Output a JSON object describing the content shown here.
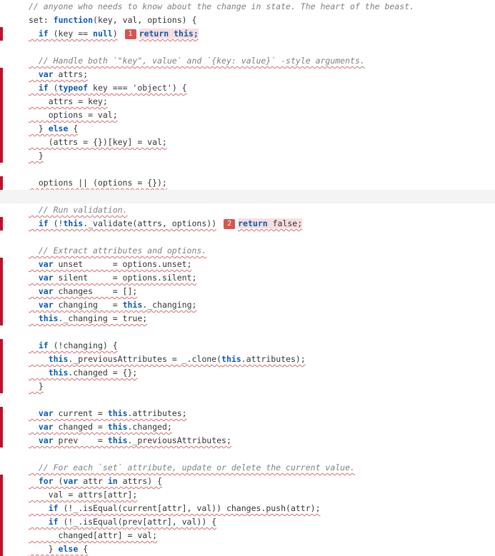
{
  "lines": [
    {
      "segs": [
        {
          "t": "// anyone who needs to know about the change in state. The heart of the beast.",
          "c": "cm"
        }
      ],
      "mark": false,
      "squig": false,
      "cls": "cover"
    },
    {
      "segs": [
        {
          "t": "set",
          "c": ""
        },
        {
          "t": ": ",
          "c": ""
        },
        {
          "t": "function",
          "c": "kw"
        },
        {
          "t": "(key, val, options) {",
          "c": ""
        }
      ],
      "mark": false,
      "squig": false,
      "cls": ""
    },
    {
      "segs": [
        {
          "t": "  if",
          "c": "kw"
        },
        {
          "t": " (key == ",
          "c": ""
        },
        {
          "t": "null",
          "c": "kw"
        },
        {
          "t": ")",
          "c": ""
        }
      ],
      "badge": "1",
      "after": [
        {
          "t": "return this;",
          "c": "kw"
        }
      ],
      "mark": true,
      "squig": true,
      "cls": ""
    },
    {
      "segs": [],
      "mark": false,
      "squig": false,
      "cls": "blank"
    },
    {
      "segs": [
        {
          "t": "  // Handle both `\"key\", value` and `{key: value}` -style arguments.",
          "c": "cm"
        }
      ],
      "mark": false,
      "squig": true,
      "cls": ""
    },
    {
      "segs": [
        {
          "t": "  var",
          "c": "kw"
        },
        {
          "t": " attrs;",
          "c": ""
        }
      ],
      "mark": true,
      "squig": true,
      "cls": ""
    },
    {
      "segs": [
        {
          "t": "  if",
          "c": "kw"
        },
        {
          "t": " (",
          "c": ""
        },
        {
          "t": "typeof",
          "c": "kw"
        },
        {
          "t": " key === ",
          "c": ""
        },
        {
          "t": "'object'",
          "c": "str"
        },
        {
          "t": ") {",
          "c": ""
        }
      ],
      "mark": true,
      "squig": true,
      "cls": ""
    },
    {
      "segs": [
        {
          "t": "    attrs = key;",
          "c": ""
        }
      ],
      "mark": true,
      "squig": true,
      "cls": ""
    },
    {
      "segs": [
        {
          "t": "    options = val;",
          "c": ""
        }
      ],
      "mark": true,
      "squig": true,
      "cls": ""
    },
    {
      "segs": [
        {
          "t": "  } ",
          "c": ""
        },
        {
          "t": "else",
          "c": "kw"
        },
        {
          "t": " {",
          "c": ""
        }
      ],
      "mark": true,
      "squig": true,
      "cls": ""
    },
    {
      "segs": [
        {
          "t": "    (attrs = {})[key] = val;",
          "c": ""
        }
      ],
      "mark": true,
      "squig": true,
      "cls": ""
    },
    {
      "segs": [
        {
          "t": "  }",
          "c": ""
        }
      ],
      "mark": true,
      "squig": true,
      "cls": ""
    },
    {
      "segs": [],
      "mark": false,
      "squig": false,
      "cls": "blank"
    },
    {
      "segs": [
        {
          "t": "  options || (options = {});",
          "c": ""
        }
      ],
      "mark": true,
      "squig": true,
      "cls": ""
    },
    {
      "segs": [],
      "mark": false,
      "squig": false,
      "cls": "band"
    },
    {
      "segs": [
        {
          "t": "  // Run validation.",
          "c": "cm"
        }
      ],
      "mark": false,
      "squig": true,
      "cls": ""
    },
    {
      "segs": [
        {
          "t": "  if",
          "c": "kw"
        },
        {
          "t": " (!",
          "c": ""
        },
        {
          "t": "this",
          "c": "kw"
        },
        {
          "t": "._validate(attrs, options))",
          "c": ""
        }
      ],
      "badge": "2",
      "after": [
        {
          "t": "return",
          "c": "kw"
        },
        {
          "t": " false;",
          "c": ""
        }
      ],
      "mark": true,
      "squig": true,
      "cls": ""
    },
    {
      "segs": [],
      "mark": false,
      "squig": false,
      "cls": "blank"
    },
    {
      "segs": [
        {
          "t": "  // Extract attributes and options.",
          "c": "cm"
        }
      ],
      "mark": false,
      "squig": true,
      "cls": ""
    },
    {
      "segs": [
        {
          "t": "  var",
          "c": "kw"
        },
        {
          "t": " unset      = options.unset;",
          "c": ""
        }
      ],
      "mark": true,
      "squig": true,
      "cls": ""
    },
    {
      "segs": [
        {
          "t": "  var",
          "c": "kw"
        },
        {
          "t": " silent     = options.silent;",
          "c": ""
        }
      ],
      "mark": true,
      "squig": true,
      "cls": ""
    },
    {
      "segs": [
        {
          "t": "  var",
          "c": "kw"
        },
        {
          "t": " changes    = [];",
          "c": ""
        }
      ],
      "mark": true,
      "squig": true,
      "cls": ""
    },
    {
      "segs": [
        {
          "t": "  var",
          "c": "kw"
        },
        {
          "t": " changing   = ",
          "c": ""
        },
        {
          "t": "this",
          "c": "kw"
        },
        {
          "t": "._changing;",
          "c": ""
        }
      ],
      "mark": true,
      "squig": true,
      "cls": ""
    },
    {
      "segs": [
        {
          "t": "  this",
          "c": "kw"
        },
        {
          "t": "._changing = true;",
          "c": ""
        }
      ],
      "mark": true,
      "squig": true,
      "cls": ""
    },
    {
      "segs": [],
      "mark": false,
      "squig": false,
      "cls": "blank"
    },
    {
      "segs": [
        {
          "t": "  if",
          "c": "kw"
        },
        {
          "t": " (!changing) {",
          "c": ""
        }
      ],
      "mark": true,
      "squig": true,
      "cls": ""
    },
    {
      "segs": [
        {
          "t": "    this",
          "c": "kw"
        },
        {
          "t": "._previousAttributes = _.clone(",
          "c": ""
        },
        {
          "t": "this",
          "c": "kw"
        },
        {
          "t": ".attributes);",
          "c": ""
        }
      ],
      "mark": true,
      "squig": true,
      "cls": ""
    },
    {
      "segs": [
        {
          "t": "    this",
          "c": "kw"
        },
        {
          "t": ".changed = {};",
          "c": ""
        }
      ],
      "mark": true,
      "squig": true,
      "cls": ""
    },
    {
      "segs": [
        {
          "t": "  }",
          "c": ""
        }
      ],
      "mark": true,
      "squig": true,
      "cls": ""
    },
    {
      "segs": [],
      "mark": false,
      "squig": false,
      "cls": "blank"
    },
    {
      "segs": [
        {
          "t": "  var",
          "c": "kw"
        },
        {
          "t": " current = ",
          "c": ""
        },
        {
          "t": "this",
          "c": "kw"
        },
        {
          "t": ".attributes;",
          "c": ""
        }
      ],
      "mark": true,
      "squig": true,
      "cls": ""
    },
    {
      "segs": [
        {
          "t": "  var",
          "c": "kw"
        },
        {
          "t": " changed = ",
          "c": ""
        },
        {
          "t": "this",
          "c": "kw"
        },
        {
          "t": ".changed;",
          "c": ""
        }
      ],
      "mark": true,
      "squig": true,
      "cls": ""
    },
    {
      "segs": [
        {
          "t": "  var",
          "c": "kw"
        },
        {
          "t": " prev    = ",
          "c": ""
        },
        {
          "t": "this",
          "c": "kw"
        },
        {
          "t": "._previousAttributes;",
          "c": ""
        }
      ],
      "mark": true,
      "squig": true,
      "cls": ""
    },
    {
      "segs": [],
      "mark": false,
      "squig": false,
      "cls": "blank"
    },
    {
      "segs": [
        {
          "t": "  // For each `set` attribute, update or delete the current value.",
          "c": "cm"
        }
      ],
      "mark": false,
      "squig": true,
      "cls": ""
    },
    {
      "segs": [
        {
          "t": "  for",
          "c": "kw"
        },
        {
          "t": " (",
          "c": ""
        },
        {
          "t": "var",
          "c": "kw"
        },
        {
          "t": " attr ",
          "c": ""
        },
        {
          "t": "in",
          "c": "kw"
        },
        {
          "t": " attrs) {",
          "c": ""
        }
      ],
      "mark": true,
      "squig": true,
      "cls": ""
    },
    {
      "segs": [
        {
          "t": "    val = attrs[attr];",
          "c": ""
        }
      ],
      "mark": true,
      "squig": true,
      "cls": ""
    },
    {
      "segs": [
        {
          "t": "    if",
          "c": "kw"
        },
        {
          "t": " (!_.isEqual(current[attr], val)) changes.push(attr);",
          "c": ""
        }
      ],
      "mark": true,
      "squig": true,
      "cls": ""
    },
    {
      "segs": [
        {
          "t": "    if",
          "c": "kw"
        },
        {
          "t": " (!_.isEqual(prev[attr], val)) {",
          "c": ""
        }
      ],
      "mark": true,
      "squig": true,
      "cls": ""
    },
    {
      "segs": [
        {
          "t": "      changed[attr] = val;",
          "c": ""
        }
      ],
      "mark": true,
      "squig": true,
      "cls": ""
    },
    {
      "segs": [
        {
          "t": "    } ",
          "c": ""
        },
        {
          "t": "else",
          "c": "kw"
        },
        {
          "t": " {",
          "c": ""
        }
      ],
      "mark": true,
      "squig": true,
      "cls": ""
    }
  ],
  "colors": {
    "marker": "#c0102a",
    "badge": "#d9534f",
    "keyword": "#0b5ab5",
    "comment": "#808080"
  }
}
